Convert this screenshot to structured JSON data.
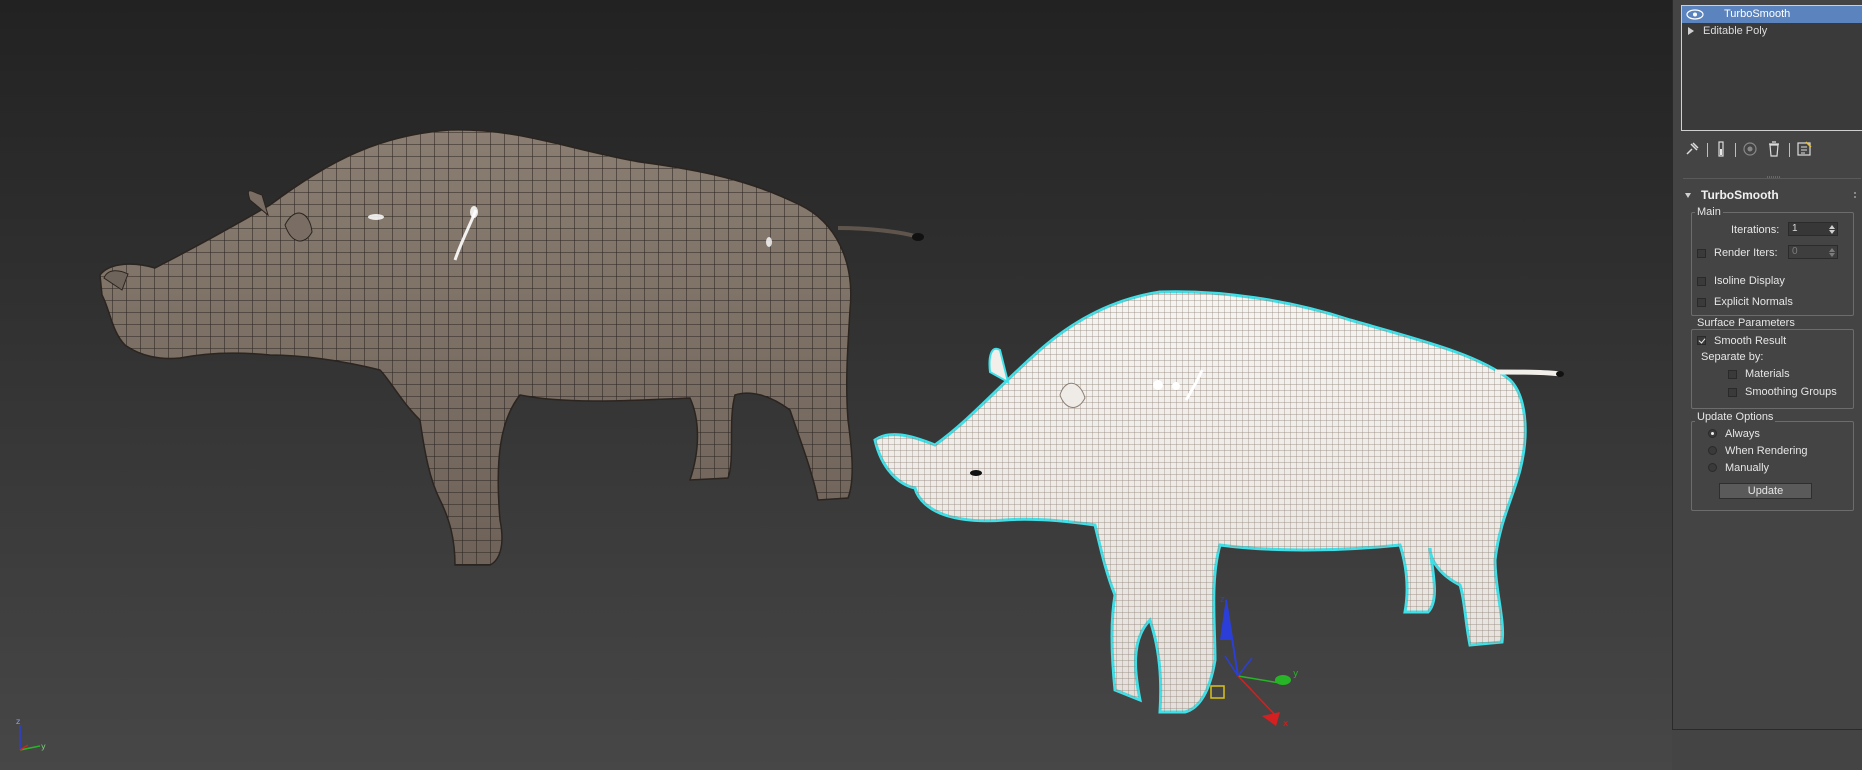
{
  "modifier_stack": [
    {
      "label": "TurboSmooth",
      "selected": true,
      "icon": "eye-icon"
    },
    {
      "label": "Editable Poly",
      "selected": false,
      "icon": "expand-triangle-icon"
    }
  ],
  "stack_toolbar": [
    "pin-stack-icon",
    "show-end-result-icon",
    "make-unique-icon",
    "remove-modifier-icon",
    "configure-modifier-sets-icon"
  ],
  "rollout": {
    "title": "TurboSmooth",
    "main": {
      "label": "Main",
      "iterations_label": "Iterations:",
      "iterations_value": "1",
      "render_iters_label": "Render Iters:",
      "render_iters_value": "0",
      "render_iters_checked": false,
      "isoline_label": "Isoline Display",
      "isoline_checked": false,
      "explicit_normals_label": "Explicit Normals",
      "explicit_normals_checked": false
    },
    "surface": {
      "label": "Surface Parameters",
      "smooth_result_label": "Smooth Result",
      "smooth_result_checked": true,
      "separate_by_label": "Separate by:",
      "materials_label": "Materials",
      "materials_checked": false,
      "smoothing_groups_label": "Smoothing Groups",
      "smoothing_groups_checked": false
    },
    "update": {
      "label": "Update Options",
      "always_label": "Always",
      "when_rendering_label": "When Rendering",
      "manually_label": "Manually",
      "selected": "Always",
      "update_button": "Update"
    }
  },
  "viewport": {
    "objects": [
      "rhino-mesh-base",
      "rhino-mesh-turbosmooth-selected"
    ],
    "axis_labels": {
      "x": "x",
      "y": "y",
      "z": "z"
    },
    "colors": {
      "selection_outline": "#3fe0e8",
      "x_axis": "#d42020",
      "y_axis": "#27b527",
      "z_axis": "#2b3fd8",
      "gizmo_center": "#d9c21a"
    }
  }
}
